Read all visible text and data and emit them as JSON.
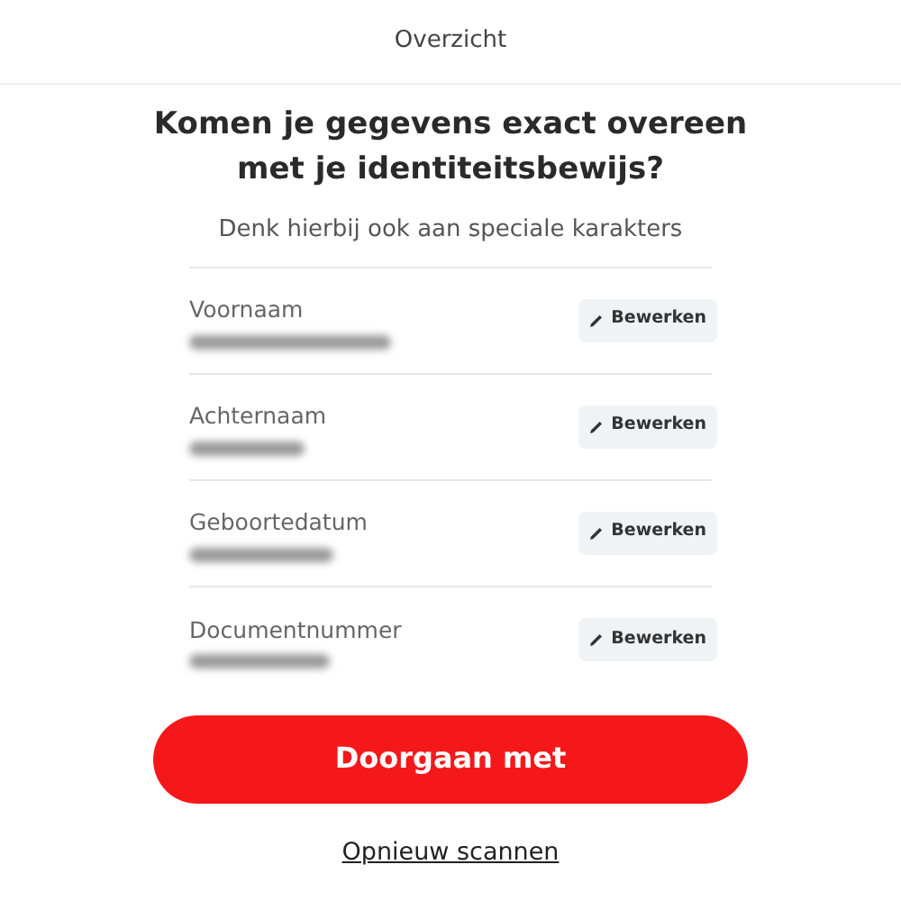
{
  "header": {
    "title": "Overzicht"
  },
  "heading": "Komen je gegevens exact overeen met je identiteitsbewijs?",
  "subtitle": "Denk hierbij ook aan speciale karakters",
  "fields": [
    {
      "label": "Voornaam",
      "redacted": true,
      "edit_label": "Bewerken"
    },
    {
      "label": "Achternaam",
      "redacted": true,
      "edit_label": "Bewerken"
    },
    {
      "label": "Geboortedatum",
      "redacted": true,
      "edit_label": "Bewerken"
    },
    {
      "label": "Documentnummer",
      "redacted": true,
      "edit_label": "Bewerken"
    }
  ],
  "primary_button": "Doorgaan met",
  "secondary_link": "Opnieuw scannen"
}
